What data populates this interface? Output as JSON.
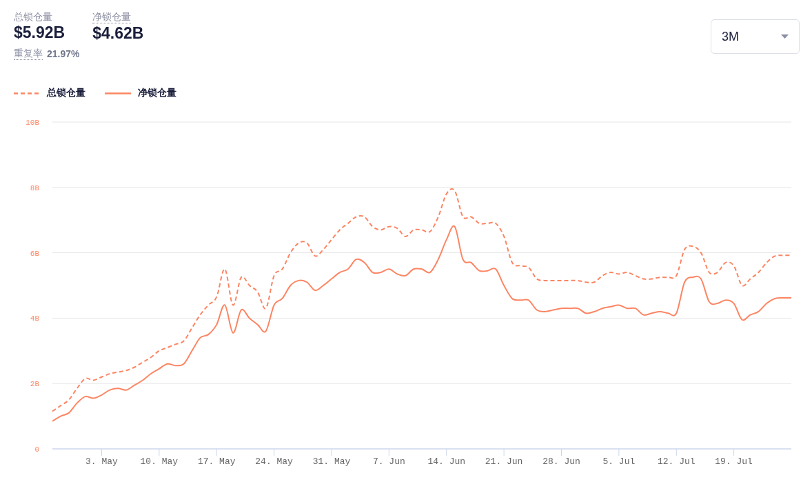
{
  "stats": [
    {
      "label": "总锁仓量",
      "value": "$5.92B",
      "tooltip": false
    },
    {
      "label": "净锁仓量",
      "value": "$4.62B",
      "tooltip": true
    }
  ],
  "overlap": {
    "label": "重复率",
    "value": "21.97%",
    "tooltip": true
  },
  "range_select": {
    "value": "3M"
  },
  "chart_data": {
    "type": "line",
    "categories": [
      null,
      null,
      null,
      null,
      null,
      null,
      "3. May",
      null,
      null,
      null,
      null,
      null,
      null,
      "10. May",
      null,
      null,
      null,
      null,
      null,
      null,
      "17. May",
      null,
      null,
      null,
      null,
      null,
      null,
      "24. May",
      null,
      null,
      null,
      null,
      null,
      null,
      "31. May",
      null,
      null,
      null,
      null,
      null,
      null,
      "7. Jun",
      null,
      null,
      null,
      null,
      null,
      null,
      "14. Jun",
      null,
      null,
      null,
      null,
      null,
      null,
      "21. Jun",
      null,
      null,
      null,
      null,
      null,
      null,
      "28. Jun",
      null,
      null,
      null,
      null,
      null,
      null,
      "5. Jul",
      null,
      null,
      null,
      null,
      null,
      null,
      "12. Jul",
      null,
      null,
      null,
      null,
      null,
      null,
      "19. Jul",
      null,
      null,
      null,
      null,
      null,
      null,
      null
    ],
    "series": [
      {
        "name": "总锁仓量",
        "color": "#fc8563",
        "line_style": "dashed",
        "values": [
          1.15,
          1.32,
          1.5,
          1.85,
          2.15,
          2.1,
          2.2,
          2.3,
          2.35,
          2.4,
          2.5,
          2.65,
          2.8,
          3.0,
          3.1,
          3.2,
          3.3,
          3.7,
          4.1,
          4.4,
          4.65,
          5.5,
          4.4,
          5.25,
          5.0,
          4.8,
          4.3,
          5.3,
          5.5,
          6.0,
          6.3,
          6.3,
          5.9,
          6.1,
          6.4,
          6.7,
          6.9,
          7.1,
          7.1,
          6.8,
          6.7,
          6.8,
          6.75,
          6.5,
          6.7,
          6.7,
          6.65,
          7.1,
          7.8,
          7.9,
          7.1,
          7.1,
          6.9,
          6.9,
          6.9,
          6.5,
          5.7,
          5.6,
          5.55,
          5.2,
          5.15,
          5.15,
          5.15,
          5.15,
          5.15,
          5.1,
          5.1,
          5.3,
          5.4,
          5.35,
          5.4,
          5.3,
          5.2,
          5.2,
          5.25,
          5.25,
          5.3,
          6.1,
          6.2,
          6.0,
          5.4,
          5.4,
          5.7,
          5.6,
          5.0,
          5.2,
          5.4,
          5.7,
          5.9,
          5.92,
          5.92
        ]
      },
      {
        "name": "净锁仓量",
        "color": "#fc8563",
        "line_style": "solid",
        "values": [
          0.85,
          1.0,
          1.1,
          1.4,
          1.6,
          1.55,
          1.65,
          1.8,
          1.85,
          1.8,
          1.95,
          2.1,
          2.3,
          2.45,
          2.6,
          2.55,
          2.6,
          3.0,
          3.4,
          3.5,
          3.8,
          4.4,
          3.55,
          4.25,
          4.0,
          3.8,
          3.6,
          4.4,
          4.6,
          5.0,
          5.15,
          5.1,
          4.85,
          5.0,
          5.2,
          5.4,
          5.5,
          5.8,
          5.7,
          5.4,
          5.4,
          5.5,
          5.35,
          5.3,
          5.5,
          5.5,
          5.4,
          5.8,
          6.4,
          6.8,
          5.8,
          5.7,
          5.45,
          5.45,
          5.5,
          5.0,
          4.6,
          4.55,
          4.55,
          4.25,
          4.2,
          4.25,
          4.3,
          4.3,
          4.3,
          4.15,
          4.2,
          4.3,
          4.35,
          4.4,
          4.3,
          4.3,
          4.1,
          4.15,
          4.2,
          4.15,
          4.15,
          5.1,
          5.25,
          5.2,
          4.5,
          4.45,
          4.55,
          4.45,
          3.95,
          4.1,
          4.2,
          4.45,
          4.6,
          4.62,
          4.62
        ]
      }
    ],
    "ylim": [
      0,
      10
    ],
    "grid": true,
    "yticks": [
      {
        "value": 0,
        "label": "0"
      },
      {
        "value": 2,
        "label": "2B"
      },
      {
        "value": 4,
        "label": "4B"
      },
      {
        "value": 6,
        "label": "6B"
      },
      {
        "value": 8,
        "label": "8B"
      },
      {
        "value": 10,
        "label": "10B"
      }
    ]
  }
}
